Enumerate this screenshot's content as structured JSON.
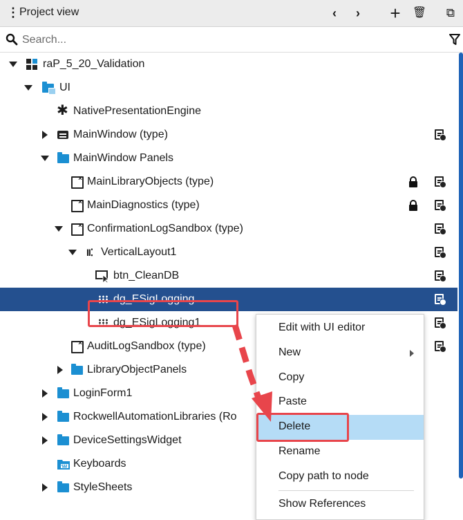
{
  "header": {
    "title": "Project view",
    "menu_glyph": "⋮",
    "back_glyph": "‹",
    "forward_glyph": "›",
    "add_glyph": "+",
    "delete_glyph": "🗑",
    "popout_glyph": "⧉"
  },
  "search": {
    "placeholder": "Search..."
  },
  "tree": [
    {
      "label": "raP_5_20_Validation",
      "icon": "project-icon",
      "expander": "expanded"
    },
    {
      "label": "UI",
      "icon": "ui-folder-icon",
      "expander": "expanded"
    },
    {
      "label": "NativePresentationEngine",
      "icon": "gear-icon"
    },
    {
      "label": "MainWindow (type)",
      "icon": "window-icon",
      "expander": "collapsed"
    },
    {
      "label": "MainWindow Panels",
      "icon": "folder-icon",
      "expander": "expanded"
    },
    {
      "label": "MainLibraryObjects (type)",
      "icon": "panel-icon",
      "locked": true
    },
    {
      "label": "MainDiagnostics (type)",
      "icon": "panel-icon",
      "locked": true
    },
    {
      "label": "ConfirmationLogSandbox (type)",
      "icon": "panel-icon",
      "expander": "expanded"
    },
    {
      "label": "VerticalLayout1",
      "icon": "vertical-layout-icon",
      "expander": "expanded"
    },
    {
      "label": "btn_CleanDB",
      "icon": "button-icon"
    },
    {
      "label": "dg_ESigLogging",
      "icon": "datagrid-icon",
      "selected": true
    },
    {
      "label": "dg_ESigLogging1",
      "icon": "datagrid-icon"
    },
    {
      "label": "AuditLogSandbox (type)",
      "icon": "panel-icon"
    },
    {
      "label": "LibraryObjectPanels",
      "icon": "folder-icon",
      "expander": "collapsed"
    },
    {
      "label": "LoginForm1",
      "icon": "folder-icon",
      "expander": "collapsed"
    },
    {
      "label": "RockwellAutomationLibraries (Ro",
      "icon": "folder-icon",
      "expander": "collapsed"
    },
    {
      "label": "DeviceSettingsWidget",
      "icon": "folder-icon",
      "expander": "collapsed"
    },
    {
      "label": "Keyboards",
      "icon": "keyboard-folder-icon"
    },
    {
      "label": "StyleSheets",
      "icon": "folder-icon",
      "expander": "collapsed"
    }
  ],
  "context_menu": {
    "items": [
      {
        "label": "Edit with UI editor"
      },
      {
        "label": "New",
        "submenu": true
      },
      {
        "label": "Copy"
      },
      {
        "label": "Paste"
      },
      {
        "label": "Delete",
        "hovered": true
      },
      {
        "label": "Rename"
      },
      {
        "label": "Copy path to node"
      },
      {
        "label": "Show References"
      }
    ]
  },
  "colors": {
    "selection": "#24508f",
    "menu_hover": "#b5dcf6",
    "annotation": "#e8454b",
    "folder": "#1b8fd2"
  }
}
